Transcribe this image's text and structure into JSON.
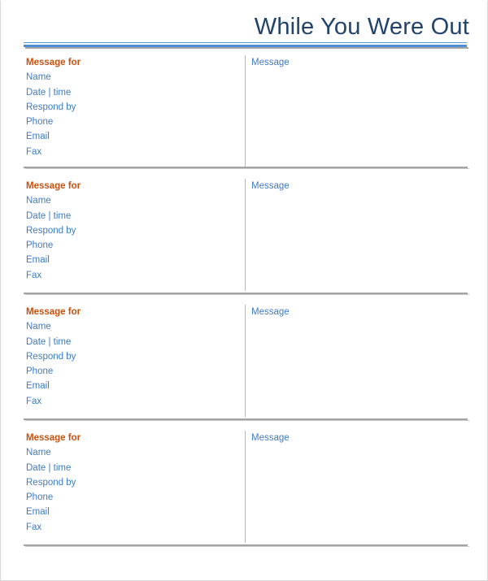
{
  "document": {
    "title": "While You Were Out",
    "accent_blue": "#3f7cc4",
    "accent_orange": "#c9500c",
    "title_color": "#22436b",
    "rule_color": "#4a90d9",
    "divider_color": "#a3a3a3"
  },
  "labels": {
    "message_for": "Message for",
    "name": "Name",
    "date_time": "Date | time",
    "respond_by": "Respond by",
    "phone": "Phone",
    "email": "Email",
    "fax": "Fax",
    "message": "Message"
  },
  "blocks": [
    {
      "index": 1,
      "fields": [
        {
          "label": "Message for",
          "value": ""
        },
        {
          "label": "Name",
          "value": ""
        },
        {
          "label": "Date | time",
          "value": ""
        },
        {
          "label": "Respond by",
          "value": ""
        },
        {
          "label": "Phone",
          "value": ""
        },
        {
          "label": "Email",
          "value": ""
        },
        {
          "label": "Fax",
          "value": ""
        }
      ],
      "message_label": "Message",
      "message_value": ""
    },
    {
      "index": 2,
      "fields": [
        {
          "label": "Message for",
          "value": ""
        },
        {
          "label": "Name",
          "value": ""
        },
        {
          "label": "Date | time",
          "value": ""
        },
        {
          "label": "Respond by",
          "value": ""
        },
        {
          "label": "Phone",
          "value": ""
        },
        {
          "label": "Email",
          "value": ""
        },
        {
          "label": "Fax",
          "value": ""
        }
      ],
      "message_label": "Message",
      "message_value": ""
    },
    {
      "index": 3,
      "fields": [
        {
          "label": "Message for",
          "value": ""
        },
        {
          "label": "Name",
          "value": ""
        },
        {
          "label": "Date | time",
          "value": ""
        },
        {
          "label": "Respond by",
          "value": ""
        },
        {
          "label": "Phone",
          "value": ""
        },
        {
          "label": "Email",
          "value": ""
        },
        {
          "label": "Fax",
          "value": ""
        }
      ],
      "message_label": "Message",
      "message_value": ""
    },
    {
      "index": 4,
      "fields": [
        {
          "label": "Message for",
          "value": ""
        },
        {
          "label": "Name",
          "value": ""
        },
        {
          "label": "Date | time",
          "value": ""
        },
        {
          "label": "Respond by",
          "value": ""
        },
        {
          "label": "Phone",
          "value": ""
        },
        {
          "label": "Email",
          "value": ""
        },
        {
          "label": "Fax",
          "value": ""
        }
      ],
      "message_label": "Message",
      "message_value": ""
    }
  ]
}
